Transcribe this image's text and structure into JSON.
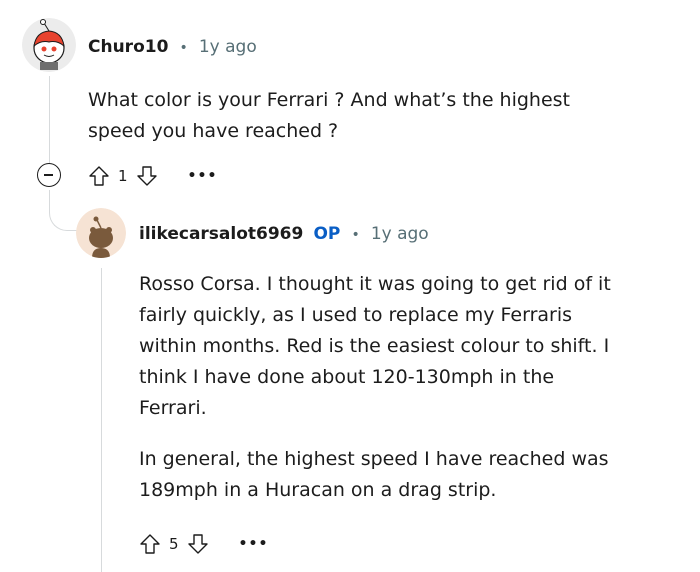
{
  "comments": [
    {
      "author": "Churo10",
      "separator": "•",
      "age": "1y ago",
      "body": [
        "What color is your Ferrari ? And what’s the highest",
        "speed you have reached ?"
      ],
      "votes": "1",
      "more_label": "•••",
      "avatar": "snoo-avatar-red"
    },
    {
      "author": "ilikecarsalot6969",
      "op_badge": "OP",
      "separator": "•",
      "age": "1y ago",
      "body": [
        "Rosso Corsa. I thought it was going to get rid of it",
        "fairly quickly, as I used to replace my Ferraris",
        "within months. Red is the easiest colour to shift. I",
        "think I have done about 120-130mph in the",
        "Ferrari.",
        "In general, the highest speed I have reached was",
        "189mph in a Huracan on a drag strip."
      ],
      "votes": "5",
      "more_label": "•••",
      "avatar": "default-snoo-avatar-tan"
    }
  ],
  "colors": {
    "op": "#0a5ec5",
    "meta": "#576f76",
    "thread_line": "#d7dadc",
    "avatar_bg_1": "#e8e8e8",
    "avatar_bg_2": "#f5e6d8"
  }
}
